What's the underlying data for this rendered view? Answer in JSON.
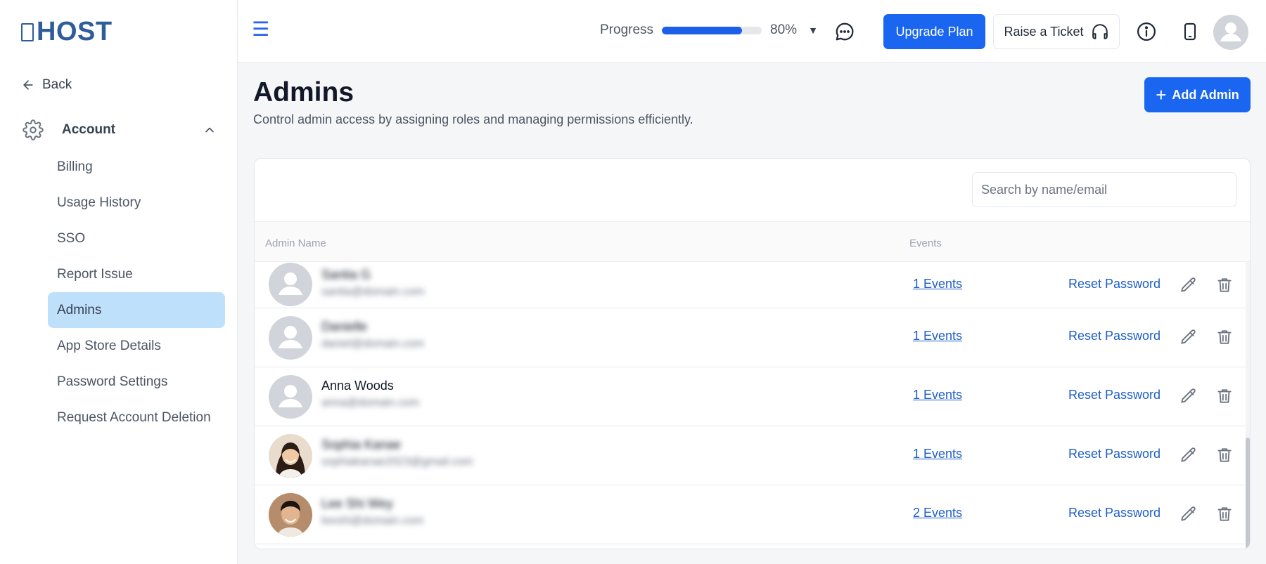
{
  "brand": {
    "logo_text": "HOST"
  },
  "sidebar": {
    "back_label": "Back",
    "section_label": "Account",
    "items": [
      {
        "label": "Billing",
        "active": false
      },
      {
        "label": "Usage History",
        "active": false
      },
      {
        "label": "SSO",
        "active": false
      },
      {
        "label": "Report Issue",
        "active": false
      },
      {
        "label": "Admins",
        "active": true
      },
      {
        "label": "App Store Details",
        "active": false
      },
      {
        "label": "Password Settings",
        "active": false
      },
      {
        "label": "Request Account Deletion",
        "active": false
      }
    ]
  },
  "header": {
    "progress_label": "Progress",
    "progress_value": 80,
    "progress_text": "80%",
    "upgrade_label": "Upgrade Plan",
    "ticket_label": "Raise a Ticket"
  },
  "page": {
    "title": "Admins",
    "subtitle": "Control admin access by assigning roles and managing permissions efficiently.",
    "add_label": "Add Admin"
  },
  "table": {
    "search_placeholder": "Search by name/email",
    "col_name": "Admin Name",
    "col_events": "Events",
    "reset_label": "Reset Password",
    "rows": [
      {
        "name": "Santia G",
        "email": "santia@domain.com",
        "events": "1 Events",
        "photo": "placeholder",
        "name_blurred": true
      },
      {
        "name": "Danielle",
        "email": "daniel@domain.com",
        "events": "1 Events",
        "photo": "placeholder",
        "name_blurred": true
      },
      {
        "name": "Anna Woods",
        "email": "anna@domain.com",
        "events": "1 Events",
        "photo": "placeholder",
        "name_blurred": false
      },
      {
        "name": "Sophia Kanae",
        "email": "sophiakanae2023@gmail.com",
        "events": "1 Events",
        "photo": "woman",
        "name_blurred": true
      },
      {
        "name": "Lee Shi Wey",
        "email": "leeshi@domain.com",
        "events": "2 Events",
        "photo": "man",
        "name_blurred": true
      }
    ]
  },
  "colors": {
    "primary": "#1a66f0",
    "link": "#1d5ec7",
    "active_nav": "#bfe0fb"
  }
}
